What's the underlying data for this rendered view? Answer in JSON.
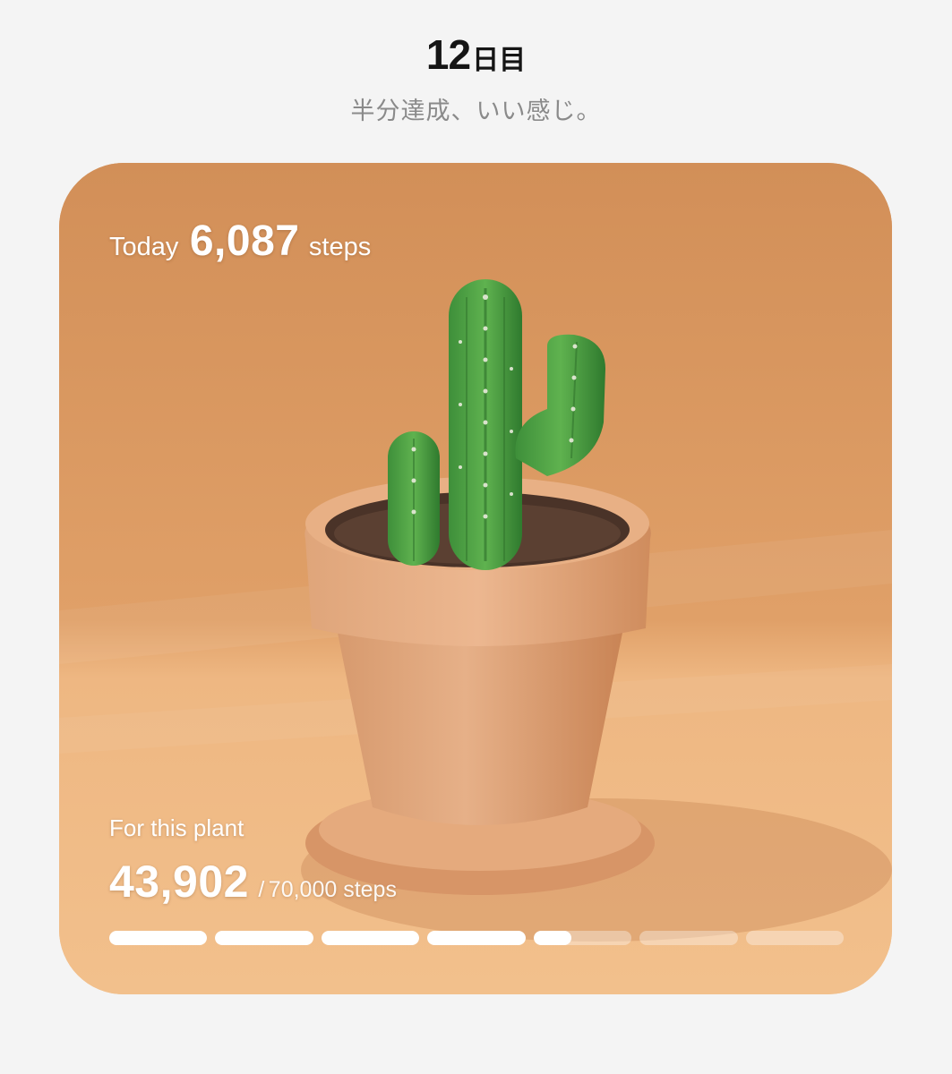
{
  "header": {
    "day_number": "12",
    "day_suffix": "日目",
    "subtitle": "半分達成、いい感じ。"
  },
  "card": {
    "image_icon": "potted-cactus-illustration",
    "today": {
      "label": "Today",
      "value": "6,087",
      "unit": "steps"
    },
    "plant": {
      "label": "For this plant",
      "current": "43,902",
      "separator": "/",
      "goal": "70,000 steps",
      "progress_fraction": 0.627,
      "segments": 7
    }
  }
}
